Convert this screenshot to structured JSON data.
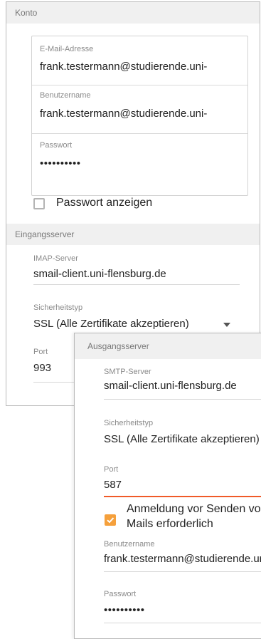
{
  "account": {
    "header": "Konto",
    "email_label": "E-Mail-Adresse",
    "email_value": "frank.testermann@studierende.uni-",
    "username_label": "Benutzername",
    "username_value": "frank.testermann@studierende.uni-",
    "password_label": "Passwort",
    "password_value": "••••••••••",
    "show_password_label": "Passwort anzeigen"
  },
  "incoming": {
    "header": "Eingangsserver",
    "imap_label": "IMAP-Server",
    "imap_value": "smail-client.uni-flensburg.de",
    "security_label": "Sicherheitstyp",
    "security_value": "SSL (Alle Zertifikate akzeptieren)",
    "port_label": "Port",
    "port_value": "993"
  },
  "outgoing": {
    "header": "Ausgangsserver",
    "smtp_label": "SMTP-Server",
    "smtp_value": "smail-client.uni-flensburg.de",
    "security_label": "Sicherheitstyp",
    "security_value": "SSL (Alle Zertifikate akzeptieren)",
    "port_label": "Port",
    "port_value": "587",
    "login_required_line1": "Anmeldung vor Senden von",
    "login_required_line2": "Mails erforderlich",
    "username_label": "Benutzername",
    "username_value": "frank.testermann@studierende.uni-flensburg.de",
    "password_label": "Passwort",
    "password_value": "••••••••••"
  },
  "colors": {
    "accent": "#f05a28",
    "checkbox_checked": "#f5a03c",
    "section_bg": "#f0f0f0"
  }
}
